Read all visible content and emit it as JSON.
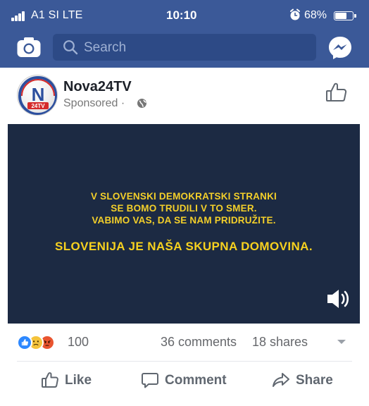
{
  "status_bar": {
    "carrier": "A1 SI  LTE",
    "time": "10:10",
    "battery": "68%",
    "battery_level": 0.68
  },
  "search": {
    "placeholder": "Search"
  },
  "post": {
    "page_name": "Nova24TV",
    "sponsored": "Sponsored ·",
    "avatar_text": "N",
    "avatar_subtext": "24TV"
  },
  "video": {
    "lines": [
      "V SLOVENSKI DEMOKRATSKI STRANKI",
      "SE BOMO TRUDILI V TO SMER.",
      "VABIMO VAS, DA SE NAM PRIDRUŽITE."
    ],
    "headline": "SLOVENIJA JE NAŠA SKUPNA DOMOVINA."
  },
  "stats": {
    "reaction_count": "100",
    "comments": "36 comments",
    "shares": "18 shares"
  },
  "actions": {
    "like": "Like",
    "comment": "Comment",
    "share": "Share"
  },
  "colors": {
    "brand_blue": "#3b5998",
    "search_bg": "#2d4a86",
    "video_bg": "#1c2a43",
    "video_text": "#f3cf2a",
    "like_blue": "#2d88ff",
    "angry_red": "#e9542f",
    "sad_yellow": "#f5c33b"
  },
  "icons": [
    "camera-icon",
    "search-icon",
    "messenger-icon",
    "globe-icon",
    "thumbs-up-icon",
    "speaker-icon",
    "comment-icon",
    "share-icon",
    "chevron-down-icon"
  ]
}
